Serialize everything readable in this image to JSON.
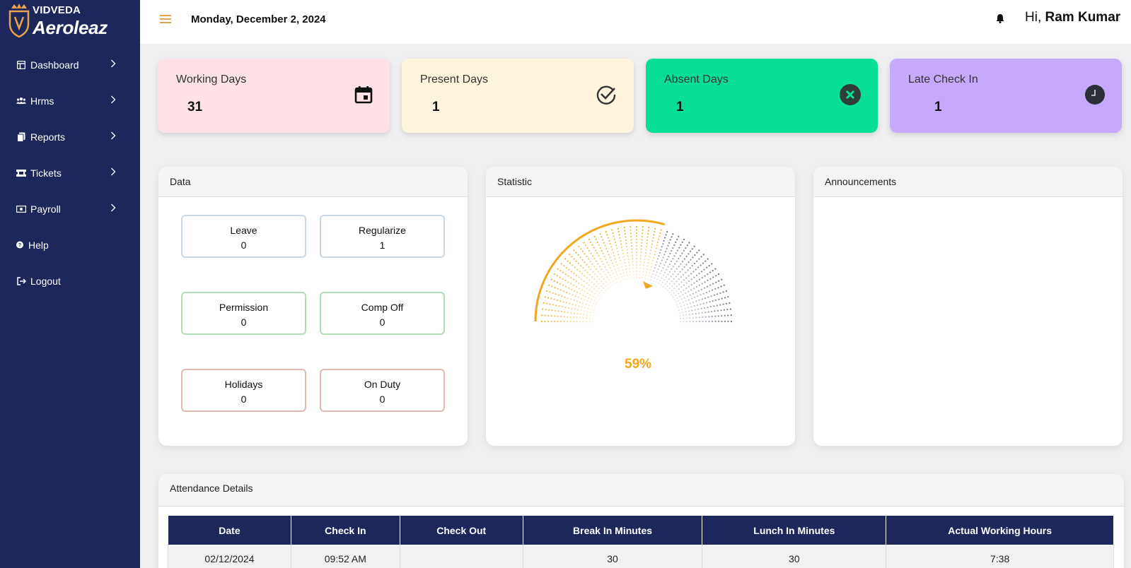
{
  "brand": {
    "top": "VIDVEDA",
    "name": "Aeroleaz"
  },
  "sidebar": {
    "items": [
      {
        "label": "Dashboard",
        "icon": "dashboard-icon",
        "has_submenu": true
      },
      {
        "label": "Hrms",
        "icon": "users-icon",
        "has_submenu": true
      },
      {
        "label": "Reports",
        "icon": "reports-icon",
        "has_submenu": true
      },
      {
        "label": "Tickets",
        "icon": "ticket-icon",
        "has_submenu": true
      },
      {
        "label": "Payroll",
        "icon": "payroll-icon",
        "has_submenu": true
      },
      {
        "label": "Help",
        "icon": "help-icon",
        "has_submenu": false
      },
      {
        "label": "Logout",
        "icon": "logout-icon",
        "has_submenu": false
      }
    ]
  },
  "header": {
    "date": "Monday, December 2, 2024",
    "greeting_prefix": "Hi,",
    "user_name": "Ram Kumar"
  },
  "stats": [
    {
      "label": "Working Days",
      "value": "31",
      "icon": "calendar-icon",
      "color": "#fde1e6"
    },
    {
      "label": "Present Days",
      "value": "1",
      "icon": "check-circle-icon",
      "color": "#fef3dd"
    },
    {
      "label": "Absent Days",
      "value": "1",
      "icon": "x-circle-icon",
      "color": "#06df94"
    },
    {
      "label": "Late Check In",
      "value": "1",
      "icon": "clock-icon",
      "color": "#c6a9fb"
    }
  ],
  "data_panel": {
    "title": "Data",
    "boxes": [
      {
        "label": "Leave",
        "value": "0"
      },
      {
        "label": "Regularize",
        "value": "1"
      },
      {
        "label": "Permission",
        "value": "0"
      },
      {
        "label": "Comp Off",
        "value": "0"
      },
      {
        "label": "Holidays",
        "value": "0"
      },
      {
        "label": "On Duty",
        "value": "0"
      }
    ]
  },
  "statistic_panel": {
    "title": "Statistic",
    "percent_label": "59%",
    "percent": 59,
    "accent": "#f0a81c"
  },
  "announcements_panel": {
    "title": "Announcements"
  },
  "attendance": {
    "title": "Attendance Details",
    "columns": [
      "Date",
      "Check In",
      "Check Out",
      "Break In Minutes",
      "Lunch In Minutes",
      "Actual Working Hours"
    ],
    "rows": [
      [
        "02/12/2024",
        "09:52 AM",
        "",
        "30",
        "30",
        "7:38"
      ]
    ]
  }
}
